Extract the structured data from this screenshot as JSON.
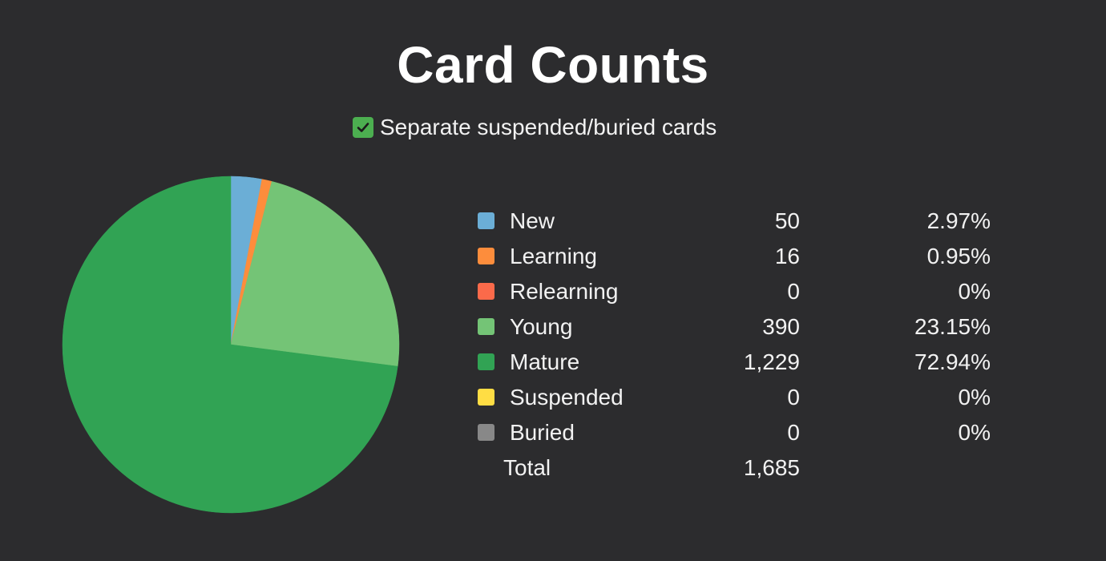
{
  "title": "Card Counts",
  "toggle": {
    "label": "Separate suspended/buried cards",
    "checked": true
  },
  "colors": {
    "background": "#2c2c2e",
    "checkbox": "#4caf50"
  },
  "chart_data": {
    "type": "pie",
    "title": "Card Counts",
    "start_angle_deg": 0,
    "direction": "clockwise",
    "slices": [
      {
        "label": "New",
        "value": 50,
        "percent": "2.97%",
        "color": "#6baed6"
      },
      {
        "label": "Learning",
        "value": 16,
        "percent": "0.95%",
        "color": "#fd8d3c"
      },
      {
        "label": "Relearning",
        "value": 0,
        "percent": "0%",
        "color": "#fb6a4a"
      },
      {
        "label": "Young",
        "value": 390,
        "percent": "23.15%",
        "color": "#74c476"
      },
      {
        "label": "Mature",
        "value": 1229,
        "percent": "72.94%",
        "color": "#31a354"
      },
      {
        "label": "Suspended",
        "value": 0,
        "percent": "0%",
        "color": "#ffdd44"
      },
      {
        "label": "Buried",
        "value": 0,
        "percent": "0%",
        "color": "#888888"
      }
    ],
    "counts_display": [
      "50",
      "16",
      "0",
      "390",
      "1,229",
      "0",
      "0"
    ],
    "total": {
      "label": "Total",
      "value": 1685,
      "display": "1,685"
    }
  }
}
